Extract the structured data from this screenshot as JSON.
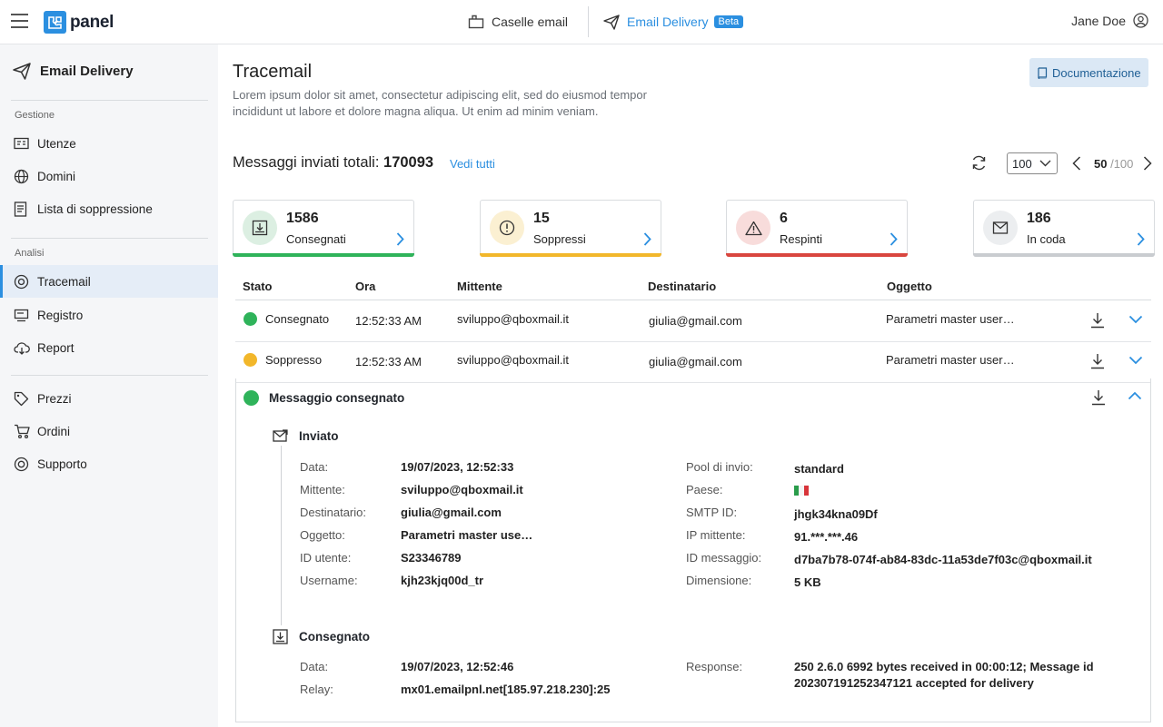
{
  "topbar": {
    "logo_text": "panel",
    "nav": [
      {
        "label": "Caselle email"
      },
      {
        "label": "Email Delivery",
        "badge": "Beta"
      }
    ],
    "user": "Jane Doe"
  },
  "sidebar": {
    "title": "Email Delivery",
    "sections": [
      {
        "label": "Gestione",
        "items": [
          "Utenze",
          "Domini",
          "Lista di soppressione"
        ]
      },
      {
        "label": "Analisi",
        "items": [
          "Tracemail",
          "Registro",
          "Report"
        ]
      },
      {
        "label": "",
        "items": [
          "Prezzi",
          "Ordini",
          "Supporto"
        ]
      }
    ],
    "active": "Tracemail"
  },
  "page": {
    "title": "Tracemail",
    "description": "Lorem ipsum dolor sit amet, consectetur adipiscing elit, sed do eiusmod tempor incididunt ut labore et dolore magna aliqua. Ut enim ad minim veniam.",
    "doc_button": "Documentazione"
  },
  "summary": {
    "label": "Messaggi inviati totali:",
    "total": "170093",
    "view_all": "Vedi tutti",
    "per_page": "100",
    "page_current": "50",
    "page_total": "/100"
  },
  "cards": [
    {
      "count": "1586",
      "label": "Consegnati",
      "color": "#2fb35a"
    },
    {
      "count": "15",
      "label": "Soppressi",
      "color": "#f2b72b"
    },
    {
      "count": "6",
      "label": "Respinti",
      "color": "#d9463f"
    },
    {
      "count": "186",
      "label": "In coda",
      "color": "#c9ccd0"
    }
  ],
  "table": {
    "headers": [
      "Stato",
      "Ora",
      "Mittente",
      "Destinatario",
      "Oggetto"
    ],
    "rows": [
      {
        "status": "Consegnato",
        "status_color": "#2fb35a",
        "time": "12:52:33 AM",
        "from": "sviluppo@qboxmail.it",
        "to": "giulia@gmail.com",
        "subject": "Parametri master user…"
      },
      {
        "status": "Soppresso",
        "status_color": "#f2b72b",
        "time": "12:52:33 AM",
        "from": "sviluppo@qboxmail.it",
        "to": "giulia@gmail.com",
        "subject": "Parametri master user…"
      }
    ]
  },
  "detail": {
    "title": "Messaggio consegnato",
    "sent": {
      "title": "Inviato",
      "left": [
        {
          "k": "Data:",
          "v": "19/07/2023, 12:52:33"
        },
        {
          "k": "Mittente:",
          "v": "sviluppo@qboxmail.it"
        },
        {
          "k": "Destinatario:",
          "v": "giulia@gmail.com"
        },
        {
          "k": "Oggetto:",
          "v": "Parametri master use…"
        },
        {
          "k": "ID utente:",
          "v": "S23346789"
        },
        {
          "k": "Username:",
          "v": "kjh23kjq00d_tr"
        }
      ],
      "right": [
        {
          "k": "Pool di invio:",
          "v": "standard"
        },
        {
          "k": "Paese:",
          "v": ""
        },
        {
          "k": "SMTP ID:",
          "v": "jhgk34kna09Df"
        },
        {
          "k": "IP mittente:",
          "v": "91.***.***.46"
        },
        {
          "k": "ID messaggio:",
          "v": "d7ba7b78-074f-ab84-83dc-11a53de7f03c@qboxmail.it"
        },
        {
          "k": "Dimensione:",
          "v": "5 KB"
        }
      ]
    },
    "delivered": {
      "title": "Consegnato",
      "left": [
        {
          "k": "Data:",
          "v": "19/07/2023, 12:52:46"
        },
        {
          "k": "Relay:",
          "v": "mx01.emailpnl.net[185.97.218.230]:25"
        }
      ],
      "response_label": "Response:",
      "response_line1": "250 2.6.0 6992 bytes received in 00:00:12; Message id",
      "response_line2": "202307191252347121 accepted for delivery"
    }
  }
}
